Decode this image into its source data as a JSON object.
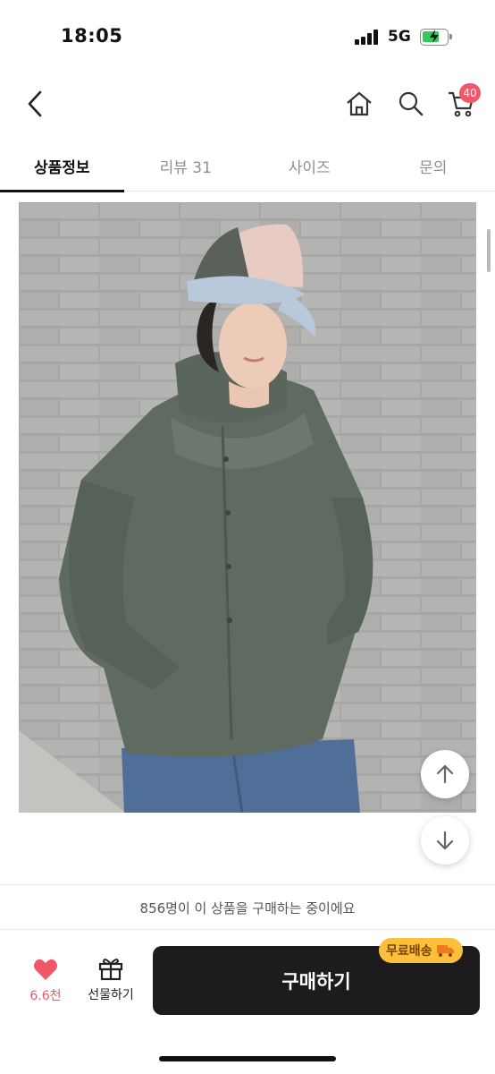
{
  "status_bar": {
    "time": "18:05",
    "network": "5G",
    "battery_color": "#34c759"
  },
  "header": {
    "back_icon": "chevron-left-icon",
    "home_icon": "home-icon",
    "search_icon": "search-icon",
    "cart_icon": "cart-icon",
    "cart_badge": "40",
    "badge_color": "#f0586a"
  },
  "tabs": [
    {
      "label": "상품정보",
      "active": true
    },
    {
      "label": "리뷰 31",
      "active": false
    },
    {
      "label": "사이즈",
      "active": false
    },
    {
      "label": "문의",
      "active": false
    }
  ],
  "product_image": {
    "icon": "product-photo",
    "description_colors": {
      "jacket": "#5f6b60",
      "wall": "#a9aaa8",
      "jeans": "#4f6f99"
    }
  },
  "floating_buttons": {
    "up_icon": "arrow-up-icon",
    "down_icon": "arrow-down-icon"
  },
  "purchase_info": {
    "text": "856명이 이 상품을 구매하는 중이에요"
  },
  "bottom_bar": {
    "like_icon": "heart-icon",
    "like_count": "6.6천",
    "gift_icon": "gift-icon",
    "gift_label": "선물하기",
    "buy_label": "구매하기",
    "shipping_badge": "무료배송",
    "shipping_icon": "truck-icon",
    "accent": "#fbbf3b",
    "buy_color": "#1c1c1e"
  }
}
